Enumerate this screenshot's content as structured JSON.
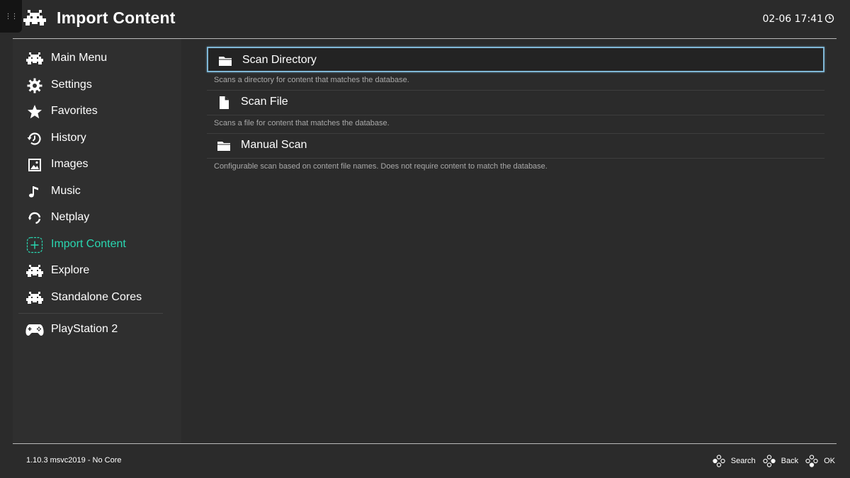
{
  "header": {
    "title": "Import Content",
    "datetime": "02-06 17:41"
  },
  "sidebar": {
    "items": [
      {
        "label": "Main Menu",
        "icon": "retroarch-invader-icon"
      },
      {
        "label": "Settings",
        "icon": "gear-icon"
      },
      {
        "label": "Favorites",
        "icon": "star-icon"
      },
      {
        "label": "History",
        "icon": "history-icon"
      },
      {
        "label": "Images",
        "icon": "image-icon"
      },
      {
        "label": "Music",
        "icon": "music-note-icon"
      },
      {
        "label": "Netplay",
        "icon": "netplay-icon"
      },
      {
        "label": "Import Content",
        "icon": "plus-icon",
        "active": true
      },
      {
        "label": "Explore",
        "icon": "retroarch-invader-icon"
      },
      {
        "label": "Standalone Cores",
        "icon": "retroarch-invader-icon"
      }
    ],
    "playlists": [
      {
        "label": "PlayStation 2",
        "icon": "gamepad-icon"
      }
    ],
    "active_color": "#29d7b1"
  },
  "main": {
    "entries": [
      {
        "label": "Scan Directory",
        "description": "Scans a directory for content that matches the database.",
        "icon": "folder-icon",
        "selected": true
      },
      {
        "label": "Scan File",
        "description": "Scans a file for content that matches the database.",
        "icon": "file-icon"
      },
      {
        "label": "Manual Scan",
        "description": "Configurable scan based on content file names. Does not require content to match the database.",
        "icon": "folder-icon"
      }
    ]
  },
  "footer": {
    "version": "1.10.3 msvc2019 - No Core",
    "actions": [
      {
        "label": "Search",
        "icon": "dpad-buttons-icon"
      },
      {
        "label": "Back",
        "icon": "dpad-buttons-icon"
      },
      {
        "label": "OK",
        "icon": "dpad-buttons-icon"
      }
    ]
  },
  "colors": {
    "background": "#2b2b2b",
    "sidebar": "#2f2f2f",
    "selection_border": "#7fb7d6",
    "accent": "#29d7b1"
  }
}
